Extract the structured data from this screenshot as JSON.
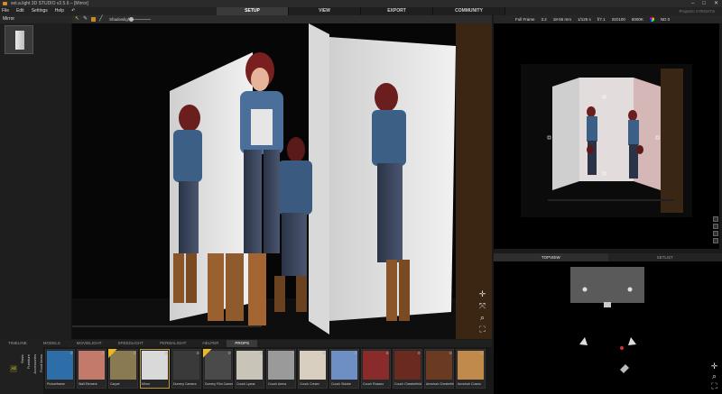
{
  "window": {
    "title": "set.a.light 3D STUDIO v2.5.6 – [Mirror]"
  },
  "menu": [
    "File",
    "Edit",
    "Settings",
    "Help"
  ],
  "modes": [
    {
      "label": "SETUP",
      "active": true
    },
    {
      "label": "VIEW",
      "active": false
    },
    {
      "label": "EXPORT",
      "active": false
    },
    {
      "label": "COMMUNITY",
      "active": false
    }
  ],
  "project_status": "Projects: 0 RIGHTS",
  "toolbar": {
    "shadowlight_label": "Shadowlight"
  },
  "left_panel": {
    "title": "Mirror"
  },
  "camera_settings": [
    "Full Frame",
    "3.2",
    "18-55 mm",
    "1/125 s",
    "f/7.1",
    "ISO100",
    "6000K",
    "ND 0"
  ],
  "view_tabs": [
    {
      "label": "TOPVIEW",
      "active": true
    },
    {
      "label": "SETLIST",
      "active": false
    }
  ],
  "bottom_tabs": [
    {
      "label": "TIMELINE",
      "active": false
    },
    {
      "label": "MODELS",
      "active": false
    },
    {
      "label": "MOVIELIGHT",
      "active": false
    },
    {
      "label": "SPEEDLIGHT",
      "active": false
    },
    {
      "label": "PERMALIGHT",
      "active": false
    },
    {
      "label": "HELPER",
      "active": false
    },
    {
      "label": "PROPS",
      "active": true
    }
  ],
  "library": {
    "all_label": "All",
    "categories": [
      "Basic",
      "Furniture",
      "Accessories",
      "Food Items"
    ],
    "items": [
      {
        "label": "Pictureframe",
        "color": "#2d6ea8",
        "new": false,
        "selected": false
      },
      {
        "label": "Wall Element",
        "color": "#c47a6a",
        "new": false,
        "selected": false
      },
      {
        "label": "Carpet",
        "color": "#8a7a52",
        "new": true,
        "selected": false
      },
      {
        "label": "Mirror",
        "color": "#d9d9d9",
        "new": false,
        "selected": true
      },
      {
        "label": "Dummy Camera",
        "color": "#3a3a3a",
        "new": false,
        "selected": false
      },
      {
        "label": "Dummy Film Camera",
        "color": "#4a4a4a",
        "new": true,
        "selected": false
      },
      {
        "label": "Couch Lyana",
        "color": "#c9c4b8",
        "new": false,
        "selected": false
      },
      {
        "label": "Couch Arena",
        "color": "#9a9a9a",
        "new": false,
        "selected": false
      },
      {
        "label": "Couch Cream",
        "color": "#d8cfc0",
        "new": false,
        "selected": false
      },
      {
        "label": "Couch Sidobe",
        "color": "#6e8fc4",
        "new": false,
        "selected": false
      },
      {
        "label": "Couch Rosano",
        "color": "#8a2b2b",
        "new": false,
        "selected": false
      },
      {
        "label": "Couch Chesterfield",
        "color": "#6a2a1f",
        "new": false,
        "selected": false
      },
      {
        "label": "Armchair Chesterfield",
        "color": "#6b3a22",
        "new": false,
        "selected": false
      },
      {
        "label": "Armchair Cosmo",
        "color": "#c08a4a",
        "new": false,
        "selected": false
      }
    ]
  }
}
